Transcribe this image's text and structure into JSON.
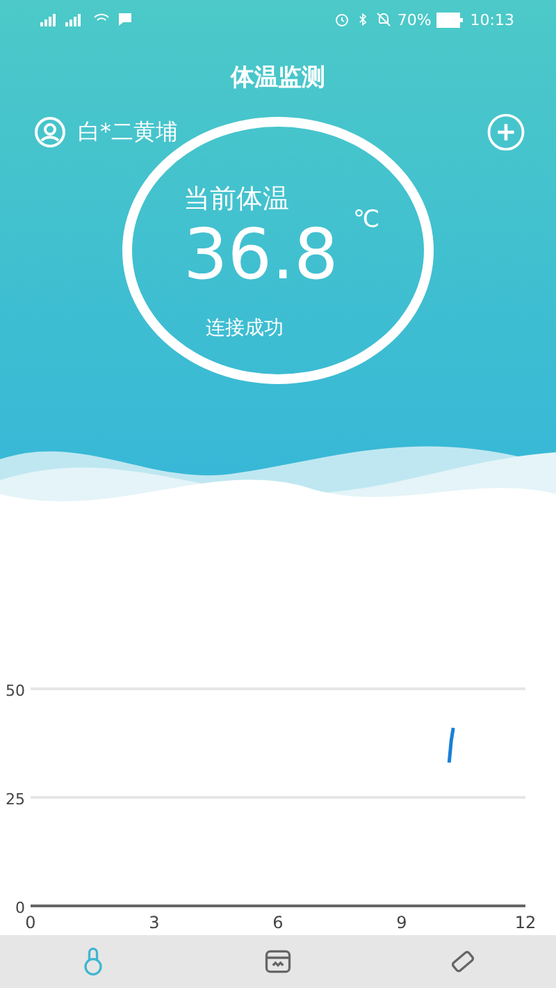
{
  "status_bar": {
    "battery": "70%",
    "time": "10:13"
  },
  "title": "体温监测",
  "user": {
    "name": "白*二黄埔"
  },
  "reading": {
    "label": "当前体温",
    "value": "36.8",
    "unit": "℃",
    "status": "连接成功"
  },
  "chart_data": {
    "type": "line",
    "x": [
      10.15,
      10.2,
      10.25
    ],
    "series": [
      {
        "color": "#1a7fd6",
        "values": [
          33,
          38,
          41
        ]
      }
    ],
    "xlim": [
      0,
      12
    ],
    "ylim": [
      0,
      50
    ],
    "xticks": [
      0,
      3,
      6,
      9,
      12
    ],
    "yticks": [
      0,
      25,
      50
    ]
  },
  "tabs": [
    {
      "kind": "thermometer",
      "selected": true
    },
    {
      "kind": "inbox",
      "selected": false
    },
    {
      "kind": "device",
      "selected": false
    }
  ]
}
